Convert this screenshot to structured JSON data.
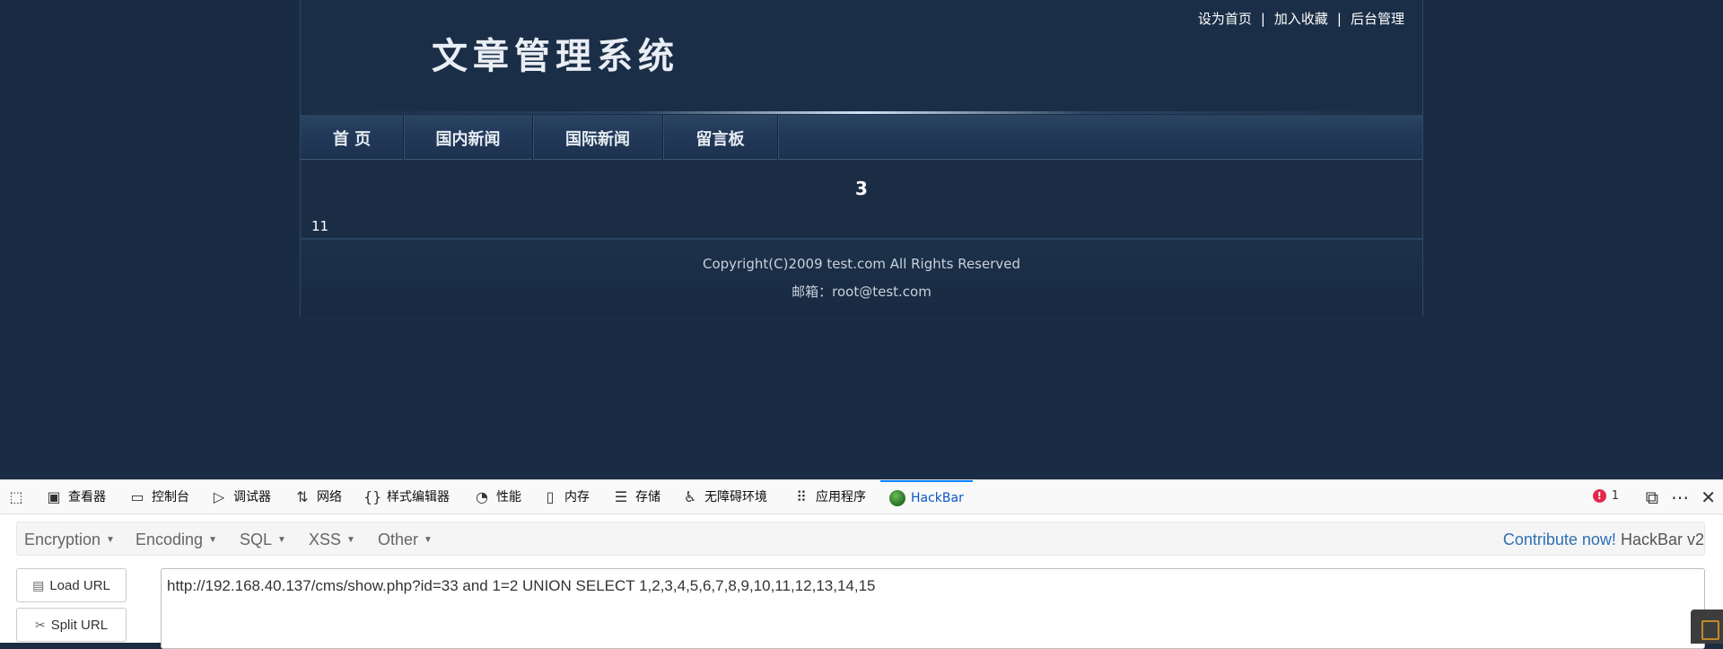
{
  "site": {
    "title": "文章管理系统",
    "top_links": [
      "设为首页",
      "加入收藏",
      "后台管理"
    ],
    "separator": "|",
    "nav": [
      "首 页",
      "国内新闻",
      "国际新闻",
      "留言板"
    ],
    "content_number": "3",
    "content_text": "11",
    "copyright": "Copyright(C)2009 test.com All Rights Reserved",
    "email": "邮箱：root@test.com"
  },
  "devtools": {
    "tabs": [
      {
        "label": "查看器",
        "icon": "inspector-icon"
      },
      {
        "label": "控制台",
        "icon": "console-icon"
      },
      {
        "label": "调试器",
        "icon": "debugger-icon"
      },
      {
        "label": "网络",
        "icon": "network-icon"
      },
      {
        "label": "样式编辑器",
        "icon": "style-editor-icon"
      },
      {
        "label": "性能",
        "icon": "performance-icon"
      },
      {
        "label": "内存",
        "icon": "memory-icon"
      },
      {
        "label": "存储",
        "icon": "storage-icon"
      },
      {
        "label": "无障碍环境",
        "icon": "accessibility-icon"
      },
      {
        "label": "应用程序",
        "icon": "application-icon"
      },
      {
        "label": "HackBar",
        "icon": "hackbar-icon"
      }
    ],
    "active_tab": "HackBar",
    "error_count": "1"
  },
  "hackbar": {
    "menus": [
      "Encryption",
      "Encoding",
      "SQL",
      "XSS",
      "Other"
    ],
    "contribute_link": "Contribute now!",
    "version": "HackBar v2",
    "load_url_label": "Load URL",
    "split_url_label": "Split URL",
    "url_value": "http://192.168.40.137/cms/show.php?id=33 and 1=2 UNION SELECT 1,2,3,4,5,6,7,8,9,10,11,12,13,14,15"
  },
  "colors": {
    "page_bg": "#192c44",
    "link_blue": "#2f6fb3",
    "active_tab": "#0a84ff",
    "error_red": "#e22850"
  }
}
